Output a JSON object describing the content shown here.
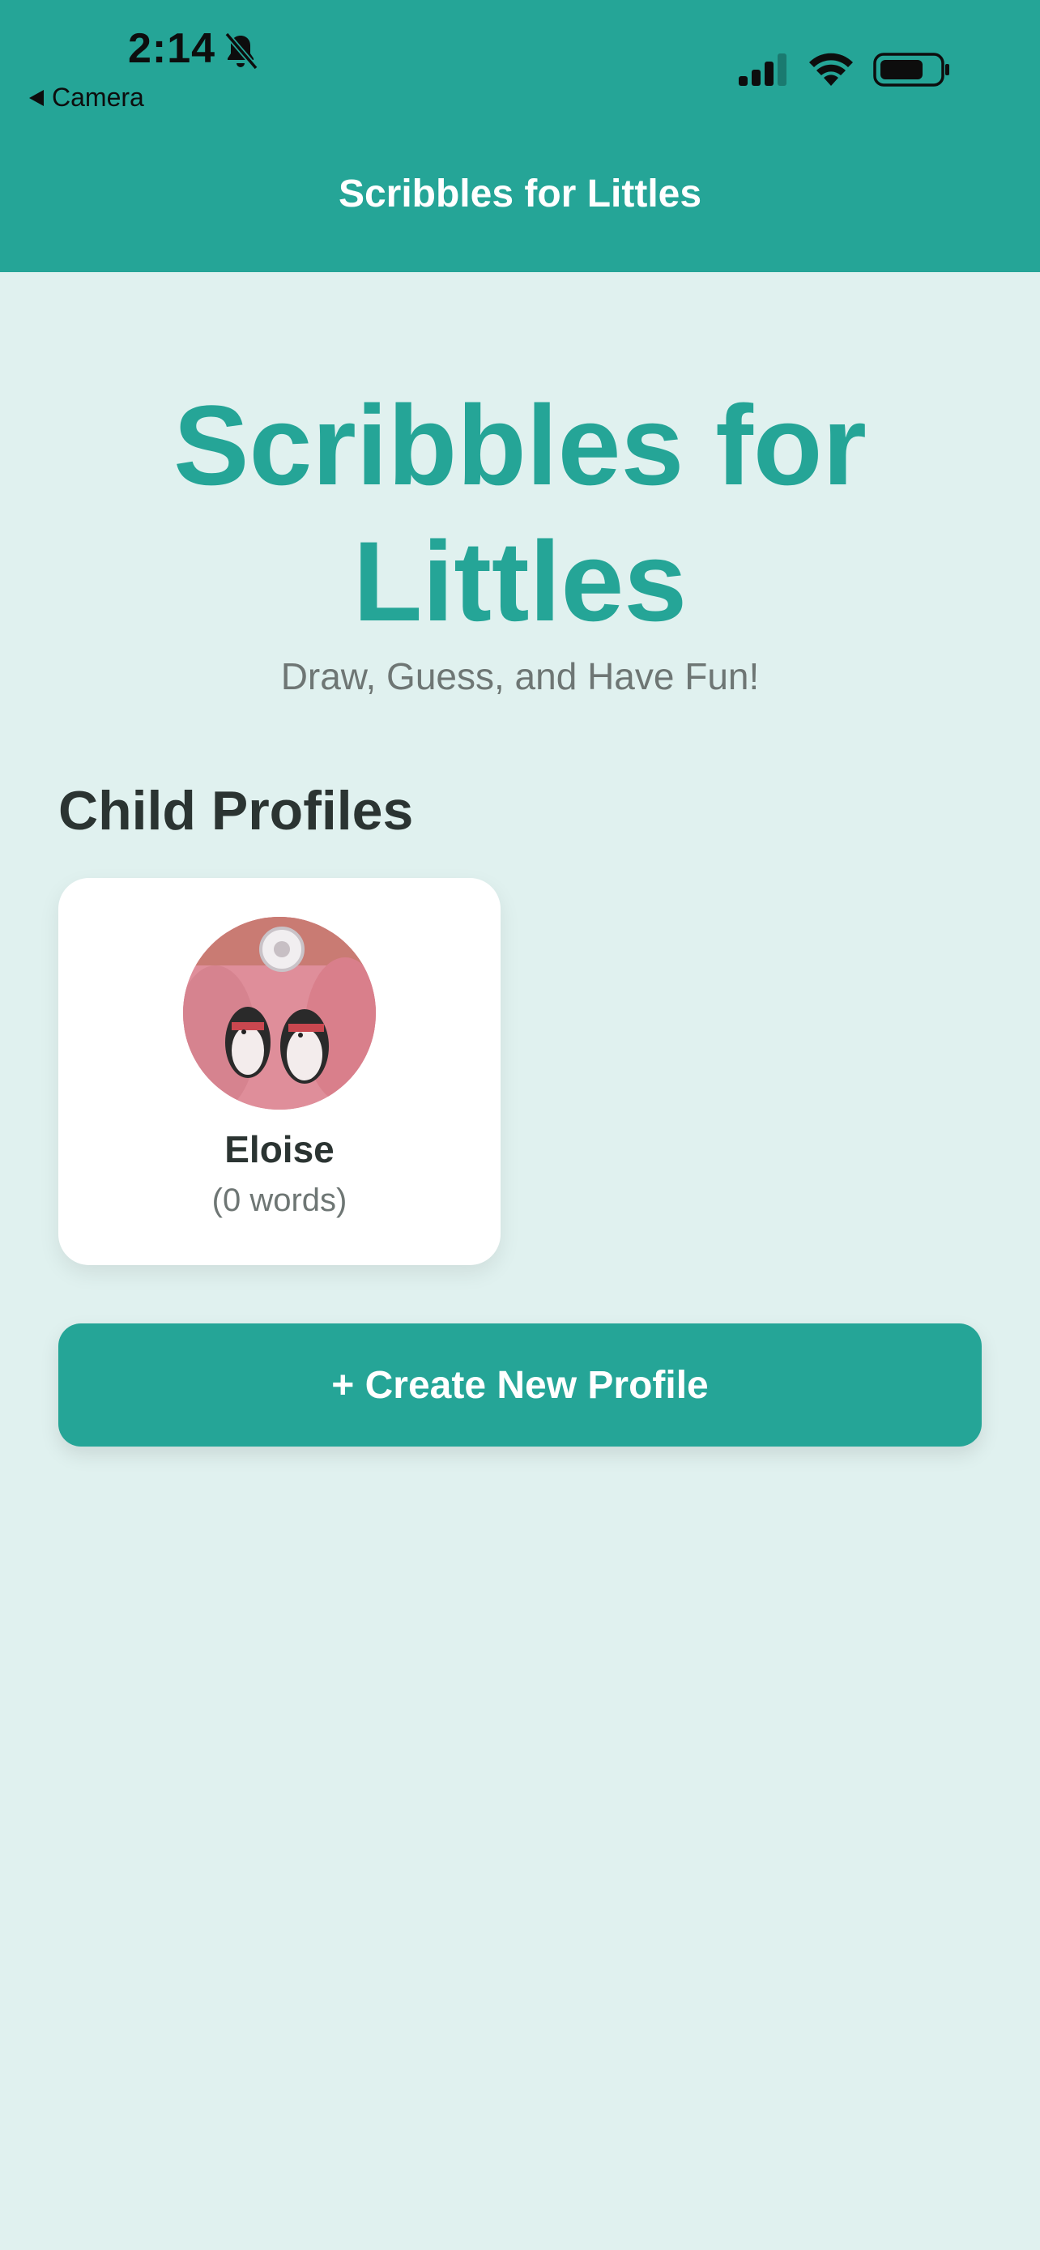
{
  "status_bar": {
    "time": "2:14",
    "back_label": "Camera",
    "icons": [
      "bell-slash-icon",
      "cellular-signal-icon",
      "wifi-icon",
      "battery-icon"
    ]
  },
  "nav": {
    "title": "Scribbles for Littles"
  },
  "hero": {
    "title_line1": "Scribbles for",
    "title_line2": "Littles",
    "subtitle": "Draw, Guess, and Have Fun!"
  },
  "profiles": {
    "section_title": "Child Profiles",
    "items": [
      {
        "name": "Eloise",
        "words": "(0 words)"
      }
    ]
  },
  "actions": {
    "create_label": "+ Create New Profile"
  },
  "colors": {
    "primary": "#25a597",
    "background": "#e0f1ef",
    "card": "#ffffff",
    "heading_text": "#2b3432",
    "muted_text": "#6e7674"
  }
}
